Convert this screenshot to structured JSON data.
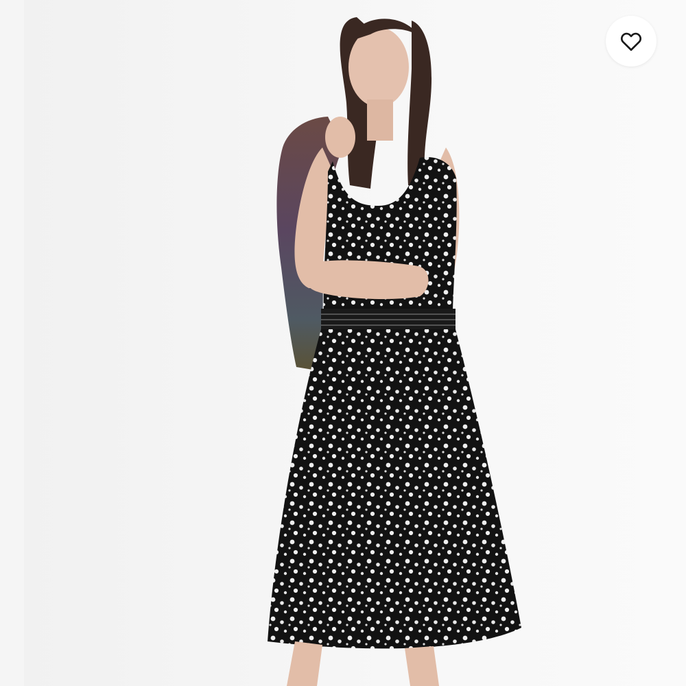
{
  "product_image": {
    "subject": "model-wearing-black-floral-midi-dress",
    "dress_color": "#111111",
    "print_color": "#f2f2f2",
    "background_color": "#f5f5f5"
  },
  "favorite": {
    "icon": "heart-outline-icon",
    "state": "not-favorited",
    "icon_color": "#1a1a1a"
  }
}
